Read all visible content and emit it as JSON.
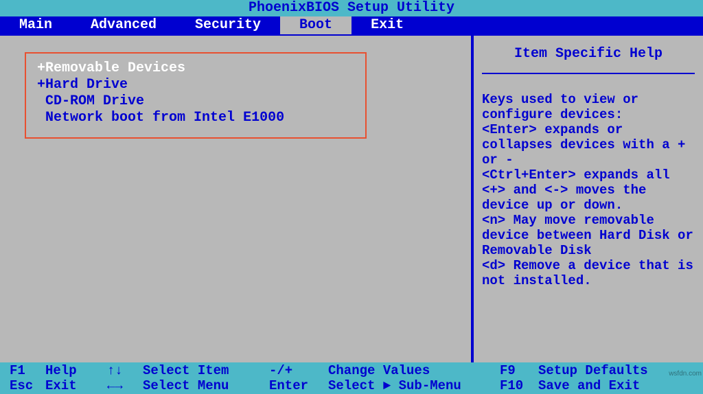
{
  "header": {
    "title": "PhoenixBIOS Setup Utility"
  },
  "menubar": {
    "items": [
      {
        "label": "Main",
        "active": false
      },
      {
        "label": "Advanced",
        "active": false
      },
      {
        "label": "Security",
        "active": false
      },
      {
        "label": "Boot",
        "active": true
      },
      {
        "label": "Exit",
        "active": false
      }
    ]
  },
  "boot": {
    "items": [
      {
        "prefix": "+",
        "label": "Removable Devices",
        "selected": true
      },
      {
        "prefix": "+",
        "label": "Hard Drive",
        "selected": false
      },
      {
        "prefix": " ",
        "label": "CD-ROM Drive",
        "selected": false
      },
      {
        "prefix": " ",
        "label": "Network boot from Intel E1000",
        "selected": false
      }
    ]
  },
  "help": {
    "title": "Item Specific Help",
    "body": "Keys used to view or configure devices:\n<Enter> expands or collapses devices with a + or -\n<Ctrl+Enter> expands all\n<+> and <-> moves the device up or down.\n<n> May move removable device between Hard Disk or Removable Disk\n<d> Remove a device that is not installed."
  },
  "footer": {
    "row1": {
      "k1": "F1",
      "l1": "Help",
      "k2": "↑↓",
      "l2": "Select Item",
      "k3": "-/+",
      "l3": "Change Values",
      "k4": "F9",
      "l4": "Setup Defaults"
    },
    "row2": {
      "k1": "Esc",
      "l1": "Exit",
      "k2": "←→",
      "l2": "Select Menu",
      "k3": "Enter",
      "l3": "Select ► Sub-Menu",
      "k4": "F10",
      "l4": "Save and Exit"
    }
  },
  "watermark": "wsfdn.com"
}
